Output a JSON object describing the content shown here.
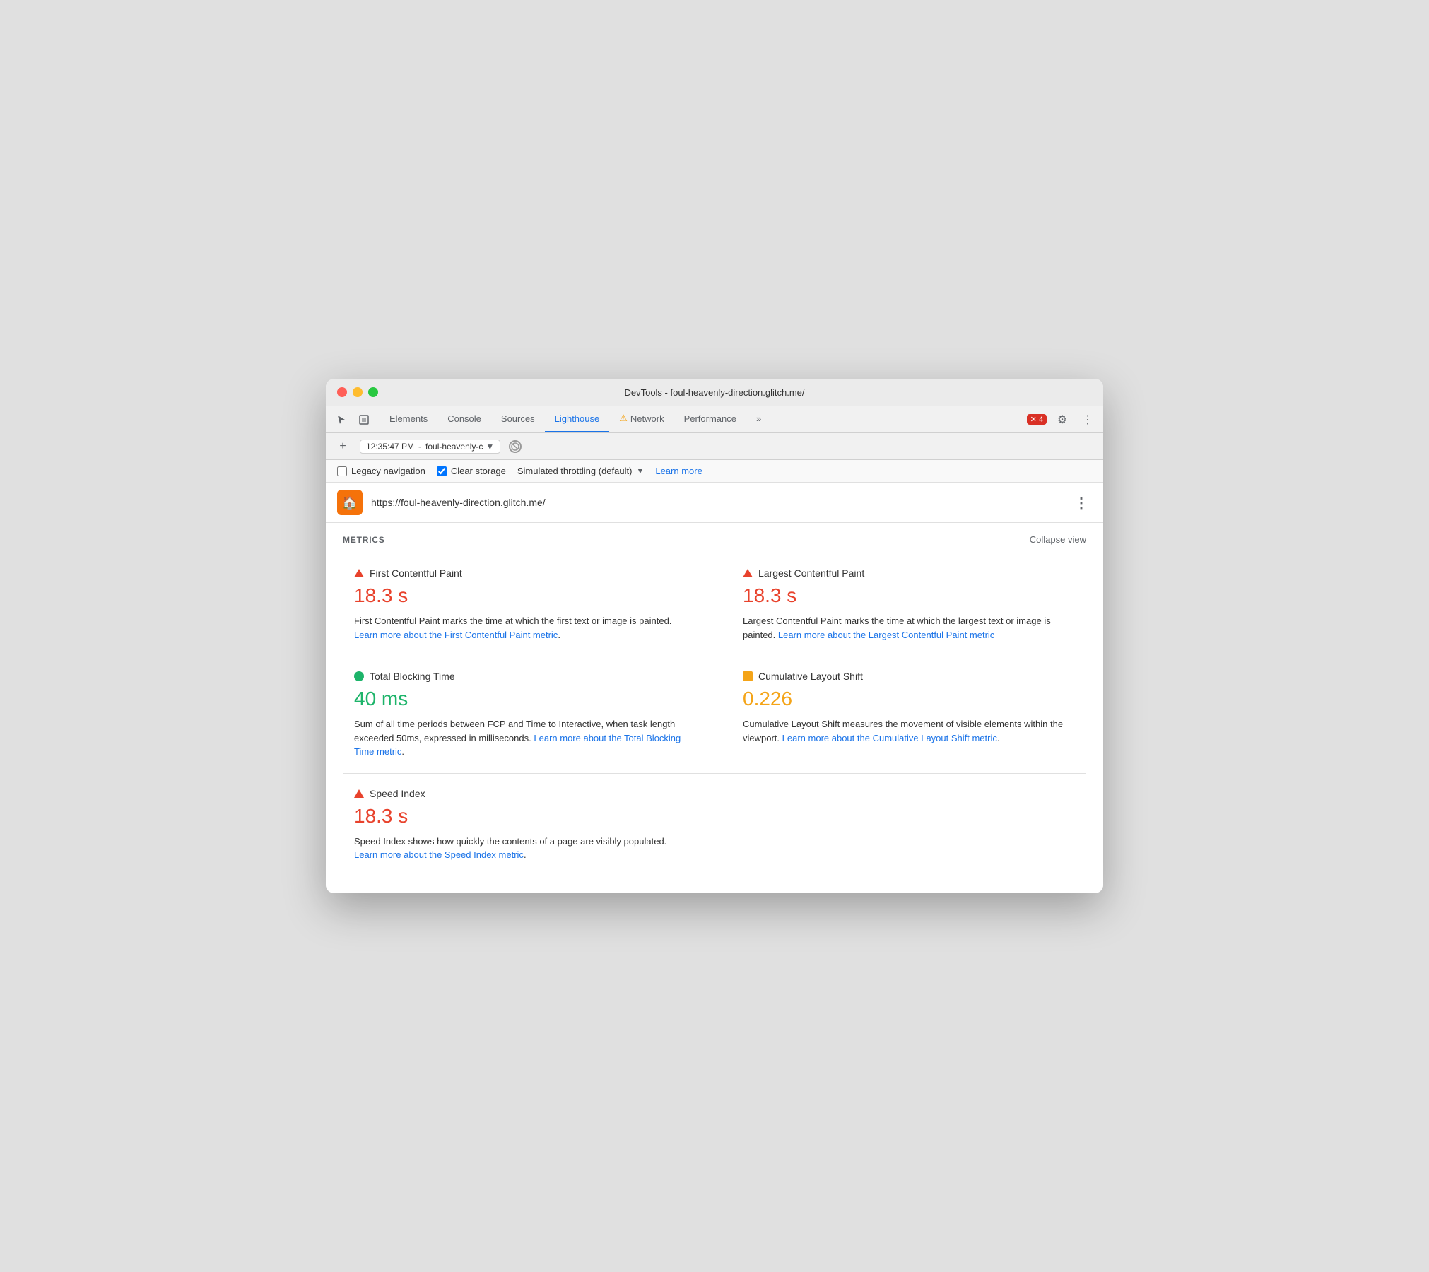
{
  "window": {
    "title": "DevTools - foul-heavenly-direction.glitch.me/"
  },
  "tabs": {
    "items": [
      {
        "label": "Elements",
        "active": false
      },
      {
        "label": "Console",
        "active": false
      },
      {
        "label": "Sources",
        "active": false
      },
      {
        "label": "Lighthouse",
        "active": true
      },
      {
        "label": "Network",
        "active": false,
        "warning": true
      },
      {
        "label": "Performance",
        "active": false
      },
      {
        "label": "»",
        "active": false
      }
    ],
    "error_count": "4",
    "error_label": "4"
  },
  "toolbar": {
    "session_time": "12:35:47 PM",
    "session_url": "foul-heavenly-c",
    "add_label": "+"
  },
  "options": {
    "legacy_navigation_label": "Legacy navigation",
    "legacy_navigation_checked": false,
    "clear_storage_label": "Clear storage",
    "clear_storage_checked": true,
    "throttling_label": "Simulated throttling (default)",
    "learn_more_label": "Learn more"
  },
  "url_bar": {
    "url": "https://foul-heavenly-direction.glitch.me/",
    "icon_emoji": "🏠"
  },
  "metrics": {
    "section_label": "METRICS",
    "collapse_label": "Collapse view",
    "items": [
      {
        "id": "fcp",
        "name": "First Contentful Paint",
        "value": "18.3 s",
        "value_color": "red",
        "indicator": "red",
        "description": "First Contentful Paint marks the time at which the first text or image is painted.",
        "link_text": "Learn more about the First Contentful Paint metric",
        "link_suffix": "."
      },
      {
        "id": "lcp",
        "name": "Largest Contentful Paint",
        "value": "18.3 s",
        "value_color": "red",
        "indicator": "red",
        "description": "Largest Contentful Paint marks the time at which the largest text or image is painted.",
        "link_text": "Learn more about the Largest Contentful Paint metric",
        "link_suffix": ""
      },
      {
        "id": "tbt",
        "name": "Total Blocking Time",
        "value": "40 ms",
        "value_color": "green",
        "indicator": "green",
        "description": "Sum of all time periods between FCP and Time to Interactive, when task length exceeded 50ms, expressed in milliseconds.",
        "link_text": "Learn more about the Total Blocking Time metric",
        "link_suffix": "."
      },
      {
        "id": "cls",
        "name": "Cumulative Layout Shift",
        "value": "0.226",
        "value_color": "orange",
        "indicator": "orange",
        "description": "Cumulative Layout Shift measures the movement of visible elements within the viewport.",
        "link_text": "Learn more about the Cumulative Layout Shift metric",
        "link_suffix": "."
      },
      {
        "id": "si",
        "name": "Speed Index",
        "value": "18.3 s",
        "value_color": "red",
        "indicator": "red",
        "description": "Speed Index shows how quickly the contents of a page are visibly populated.",
        "link_text": "Learn more about the Speed Index metric",
        "link_suffix": ".",
        "full_width": false
      }
    ]
  }
}
